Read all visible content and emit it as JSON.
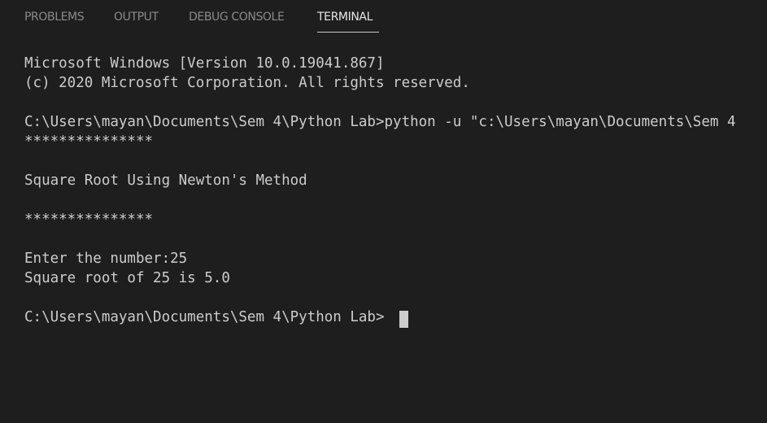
{
  "tabs": [
    {
      "label": "PROBLEMS",
      "active": false
    },
    {
      "label": "OUTPUT",
      "active": false
    },
    {
      "label": "DEBUG CONSOLE",
      "active": false
    },
    {
      "label": "TERMINAL",
      "active": true
    }
  ],
  "terminal": {
    "lines": [
      "Microsoft Windows [Version 10.0.19041.867]",
      "(c) 2020 Microsoft Corporation. All rights reserved.",
      "C:\\Users\\mayan\\Documents\\Sem 4\\Python Lab>python -u \"c:\\Users\\mayan\\Documents\\Sem 4",
      "***************",
      "Square Root Using Newton's Method",
      "***************",
      "Enter the number:25",
      "Square root of 25 is 5.0",
      "C:\\Users\\mayan\\Documents\\Sem 4\\Python Lab>"
    ]
  }
}
